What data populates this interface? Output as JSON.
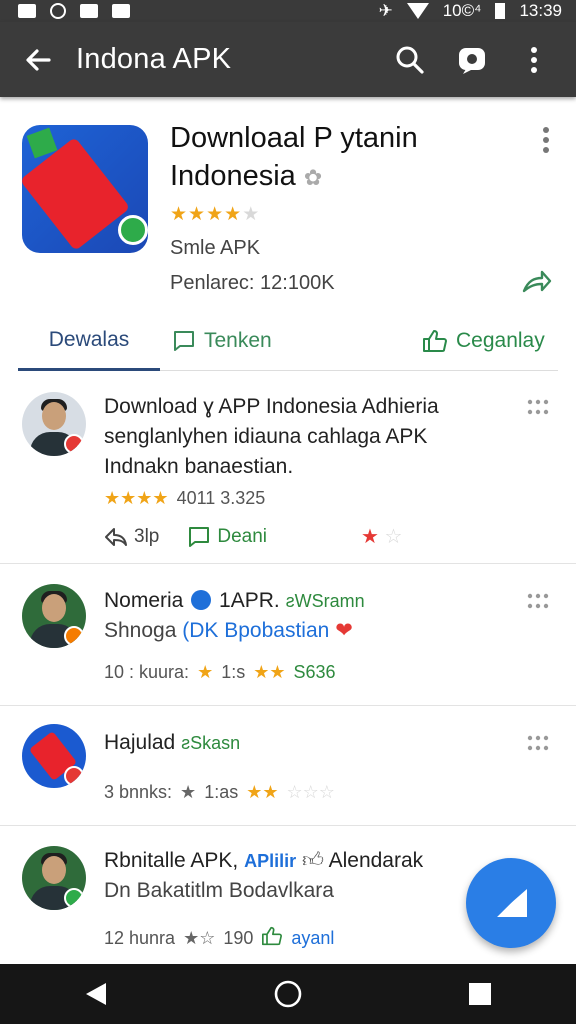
{
  "status_bar": {
    "network": "10©⁴",
    "time": "13:39"
  },
  "app_bar": {
    "title": "Indona APK"
  },
  "hero": {
    "title_line1": "Downloaal P ytanin",
    "title_line2": "Indonesia",
    "rating_stars": 4,
    "rating_max": 5,
    "subtitle": "Smle APK",
    "downloads": "Penlarec: 12:100K"
  },
  "tabs": [
    {
      "label": "Dewalas"
    },
    {
      "label": "Tenken"
    },
    {
      "label": "Ceganlay"
    }
  ],
  "reviews": [
    {
      "title": "Download ɣ APP Indonesia Adhieria",
      "body_line2": "senglanlyhen idiauna cahlaga APK",
      "body_line3": "Indnakn banaestian.",
      "rating_stars": 4,
      "count": "4011 3.325",
      "action_1": "3lp",
      "action_2": "Deani",
      "badge_color": "#e53935"
    },
    {
      "name": "Nomeria",
      "handle": "1APR.",
      "tag": "ƨWSramn",
      "line2_prefix": "Shnoga",
      "line2_link": "(DK Bpobastian",
      "meta_text": "10 : kuura:",
      "meta_rate": "1:s",
      "meta_score": "S636",
      "badge_color": "#f57c00"
    },
    {
      "name": "Hajulad",
      "tag": "ƨSkasn",
      "meta_text": "3 bnnks:",
      "meta_rate": "1:as",
      "badge_color": "#e53935"
    },
    {
      "name": "Rbnitalle APK,",
      "tag": "APlilir",
      "extra": "Alendarak",
      "line2": "Dn Bakatitlm Bodavlkara",
      "meta_text": "12 hunra",
      "meta_rate": "190",
      "meta_link": "ayanl",
      "badge_color": "#2eab4a"
    }
  ]
}
